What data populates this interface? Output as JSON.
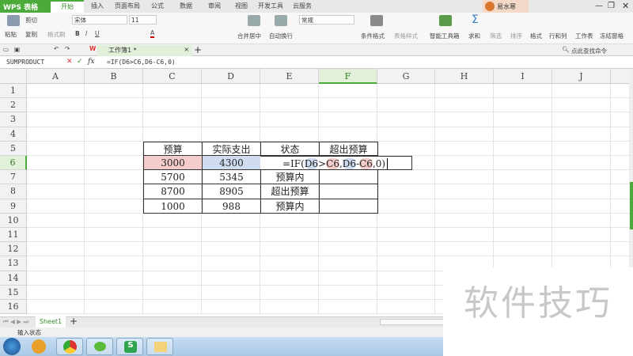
{
  "app": {
    "title": "WPS 表格"
  },
  "tabs": [
    "开始",
    "插入",
    "页面布局",
    "公式",
    "数据",
    "审阅",
    "视图",
    "开发工具",
    "云服务"
  ],
  "user": {
    "name": "易水寒"
  },
  "ribbon": {
    "paste": "粘贴",
    "cut": "剪切",
    "copy": "复制",
    "format_painter": "格式刷",
    "font": "宋体",
    "size": "11",
    "merge": "合并居中",
    "wrap": "自动换行",
    "number_format": "常规",
    "cond_format": "条件格式",
    "table_style": "表格样式",
    "smart_toolbox": "智能工具箱",
    "sum": "求和",
    "filter": "筛选",
    "sort": "排序",
    "format": "格式",
    "row_col": "行和列",
    "worksheet": "工作表",
    "freeze": "冻结窗格",
    "search": "点此查找命令"
  },
  "document": {
    "tab": "工作簿1 *"
  },
  "formula_bar": {
    "name_box": "SUMPRODUCT",
    "fx": "fx",
    "formula": "=IF(D6>C6,D6-C6,0)"
  },
  "columns": [
    "A",
    "B",
    "C",
    "D",
    "E",
    "F",
    "G",
    "H",
    "I",
    "J"
  ],
  "rows": [
    "1",
    "2",
    "3",
    "4",
    "5",
    "6",
    "7",
    "8",
    "9",
    "10",
    "11",
    "12",
    "13",
    "14",
    "15",
    "16"
  ],
  "table": {
    "headers": [
      "预算",
      "实际支出",
      "状态",
      "超出预算"
    ],
    "rows": [
      [
        "3000",
        "4300",
        "",
        ""
      ],
      [
        "5700",
        "5345",
        "预算内",
        ""
      ],
      [
        "8700",
        "8905",
        "超出预算",
        ""
      ],
      [
        "1000",
        "988",
        "预算内",
        ""
      ]
    ],
    "editing": {
      "prefix": "=IF(",
      "r1": "D6",
      ">": ">",
      "r2": "C6",
      "mid": ",",
      "r3": "D6",
      "minus": "-",
      "r4": "C6",
      "suffix": ",0)"
    }
  },
  "sheets": [
    "Sheet1"
  ],
  "status": {
    "mode": "输入状态"
  },
  "watermark": "软件技巧",
  "colors": {
    "accent": "#4caa3b",
    "ref_red": "#f4cccc",
    "ref_blue": "#cfdcf0"
  }
}
